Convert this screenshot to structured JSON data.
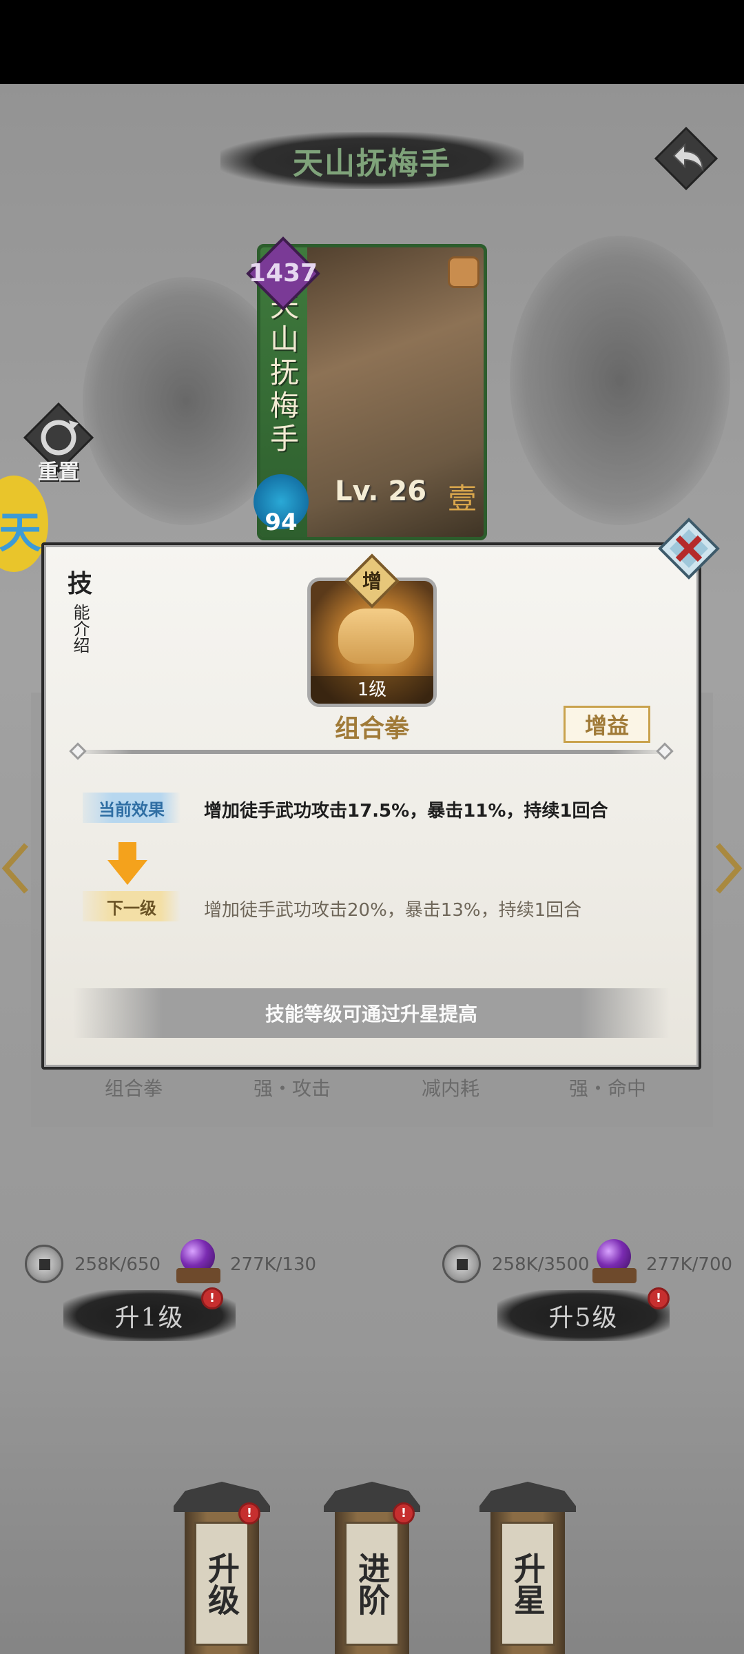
{
  "header": {
    "title": "天山抚梅手"
  },
  "card": {
    "name": "天山抚梅手",
    "power": "1437",
    "level_text": "Lv. 26",
    "rank": "壹",
    "cost": "94"
  },
  "reset": {
    "label": "重置"
  },
  "side_badge": {
    "glyph": "天"
  },
  "skill_tabs": [
    "组合拳",
    "强・攻击",
    "减内耗",
    "强・命中"
  ],
  "upgrade_left": {
    "coins": "258K/650",
    "orbs": "277K/130",
    "button_label": "升1级"
  },
  "upgrade_right": {
    "coins": "258K/3500",
    "orbs": "277K/700",
    "button_label": "升5级"
  },
  "notification_badge": "!",
  "bottom_nav": [
    {
      "label": "升级"
    },
    {
      "label": "进阶"
    },
    {
      "label": "升星"
    }
  ],
  "modal": {
    "side_title_main": "技",
    "side_title_sub": "能介绍",
    "skill_tag": "增",
    "skill_level": "1级",
    "skill_name": "组合拳",
    "buff_type": "增益",
    "current_label": "当前效果",
    "current_effect": "增加徒手武功攻击17.5%，暴击11%，持续1回合",
    "next_label": "下一级",
    "next_effect": "增加徒手武功攻击20%，暴击13%，持续1回合",
    "hint": "技能等级可通过升星提高"
  },
  "colors": {
    "title_green": "#7fa37a",
    "accent_gold": "#a07a37",
    "current_blue": "#2f6ea3",
    "badge_red": "#c62f2f"
  },
  "icons": [
    "back-arrow-icon",
    "reset-icon",
    "close-icon",
    "coin-icon",
    "purple-orb-icon",
    "down-arrow-icon",
    "fist-icon"
  ]
}
